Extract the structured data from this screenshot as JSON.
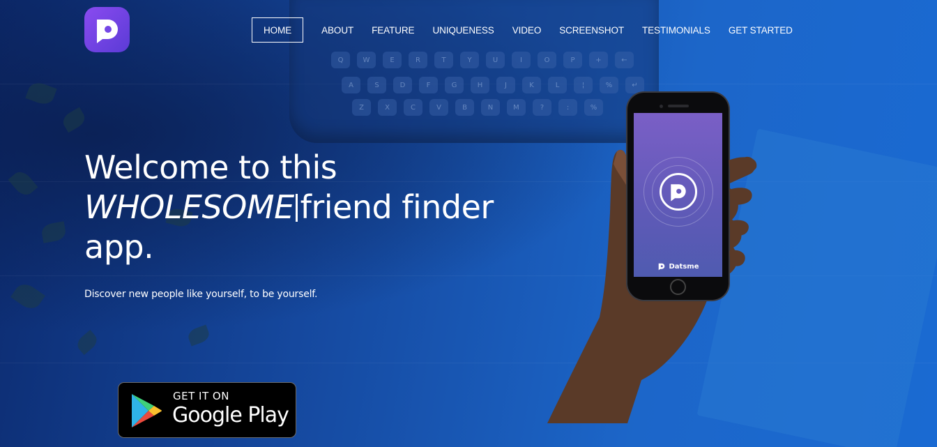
{
  "brand": {
    "logo_icon": "datsme-logo-icon",
    "colors": {
      "logo_gradient_start": "#8a4bf0",
      "logo_gradient_end": "#5b3bd6",
      "hero_blue": "#1a5fc4"
    }
  },
  "nav": {
    "items": [
      {
        "label": "HOME",
        "active": true
      },
      {
        "label": "ABOUT"
      },
      {
        "label": "FEATURE"
      },
      {
        "label": "UNIQUENESS"
      },
      {
        "label": "VIDEO"
      },
      {
        "label": "SCREENSHOT"
      },
      {
        "label": "TESTIMONIALS"
      },
      {
        "label": "GET STARTED"
      }
    ]
  },
  "hero": {
    "headline_line1": "Welcome to this",
    "headline_highlight": "WHOLESOME",
    "headline_line2_rest": "friend finder",
    "headline_line3": "app.",
    "subtitle": "Discover new people like yourself, to be yourself."
  },
  "store_badge": {
    "small_text": "GET IT ON",
    "big_text": "Google Play",
    "icon": "google-play-icon"
  },
  "phone": {
    "app_name": "Datsme",
    "app_icon": "datsme-logo-icon"
  },
  "background": {
    "typewriter_keys": {
      "row1": [
        "Q",
        "W",
        "E",
        "R",
        "T",
        "Y",
        "U",
        "I",
        "O",
        "P",
        "+",
        "←"
      ],
      "row2": [
        "A",
        "S",
        "D",
        "F",
        "G",
        "H",
        "J",
        "K",
        "L",
        "¦",
        "%",
        "↵"
      ],
      "row3": [
        "Z",
        "X",
        "C",
        "V",
        "B",
        "N",
        "M",
        "?",
        ":",
        "%"
      ]
    }
  }
}
